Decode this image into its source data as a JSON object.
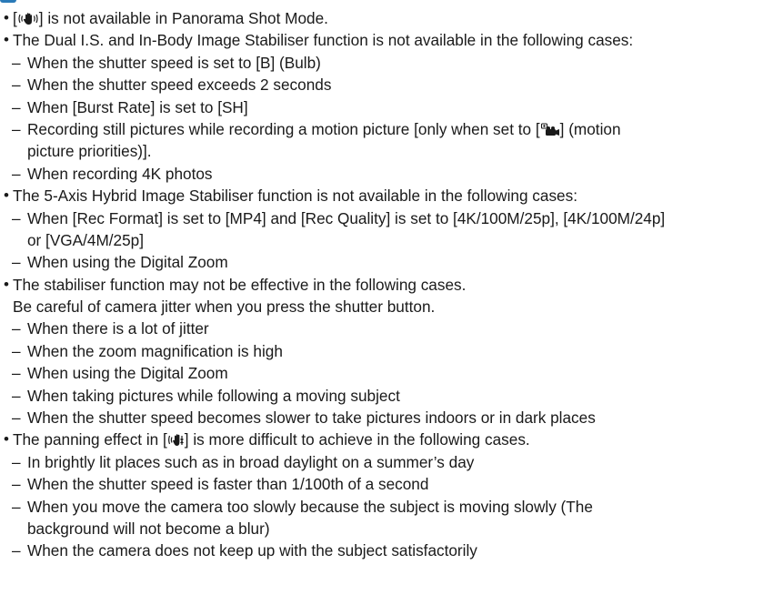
{
  "accent_color": "#2a7ab8",
  "icons": {
    "stabiliser": "stabiliser-hand-icon",
    "panning": "panning-stabiliser-icon",
    "motion_priority": "motion-picture-priority-camera-icon"
  },
  "lines": {
    "l1_pre": "[",
    "l1_post": "] is not available in Panorama Shot Mode.",
    "l2": "The Dual I.S. and In-Body Image Stabiliser function is not available in the following cases:",
    "l3": "When the shutter speed is set to [B] (Bulb)",
    "l4": "When the shutter speed exceeds 2 seconds",
    "l5": "When [Burst Rate] is set to [SH]",
    "l6_pre": "Recording still pictures while recording a motion picture [only when set to [",
    "l6_post": "] (motion",
    "l7": "picture priorities)].",
    "l8": "When recording 4K photos",
    "l9": "The 5-Axis Hybrid Image Stabiliser function is not available in the following cases:",
    "l10": "When [Rec Format] is set to [MP4] and [Rec Quality] is set to [4K/100M/25p], [4K/100M/24p]",
    "l11": "or [VGA/4M/25p]",
    "l12": "When using the Digital Zoom",
    "l13": "The stabiliser function may not be effective in the following cases.",
    "l14": "Be careful of camera jitter when you press the shutter button.",
    "l15": "When there is a lot of jitter",
    "l16": "When the zoom magnification is high",
    "l17": "When using the Digital Zoom",
    "l18": "When taking pictures while following a moving subject",
    "l19": "When the shutter speed becomes slower to take pictures indoors or in dark places",
    "l20_pre": "The panning effect in [",
    "l20_post": "] is more difficult to achieve in the following cases.",
    "l21": "In brightly lit places such as in broad daylight on a summer’s day",
    "l22": "When the shutter speed is faster than 1/100th of a second",
    "l23": "When you move the camera too slowly because the subject is moving slowly (The",
    "l24": "background will not become a blur)",
    "l25": "When the camera does not keep up with the subject satisfactorily"
  }
}
